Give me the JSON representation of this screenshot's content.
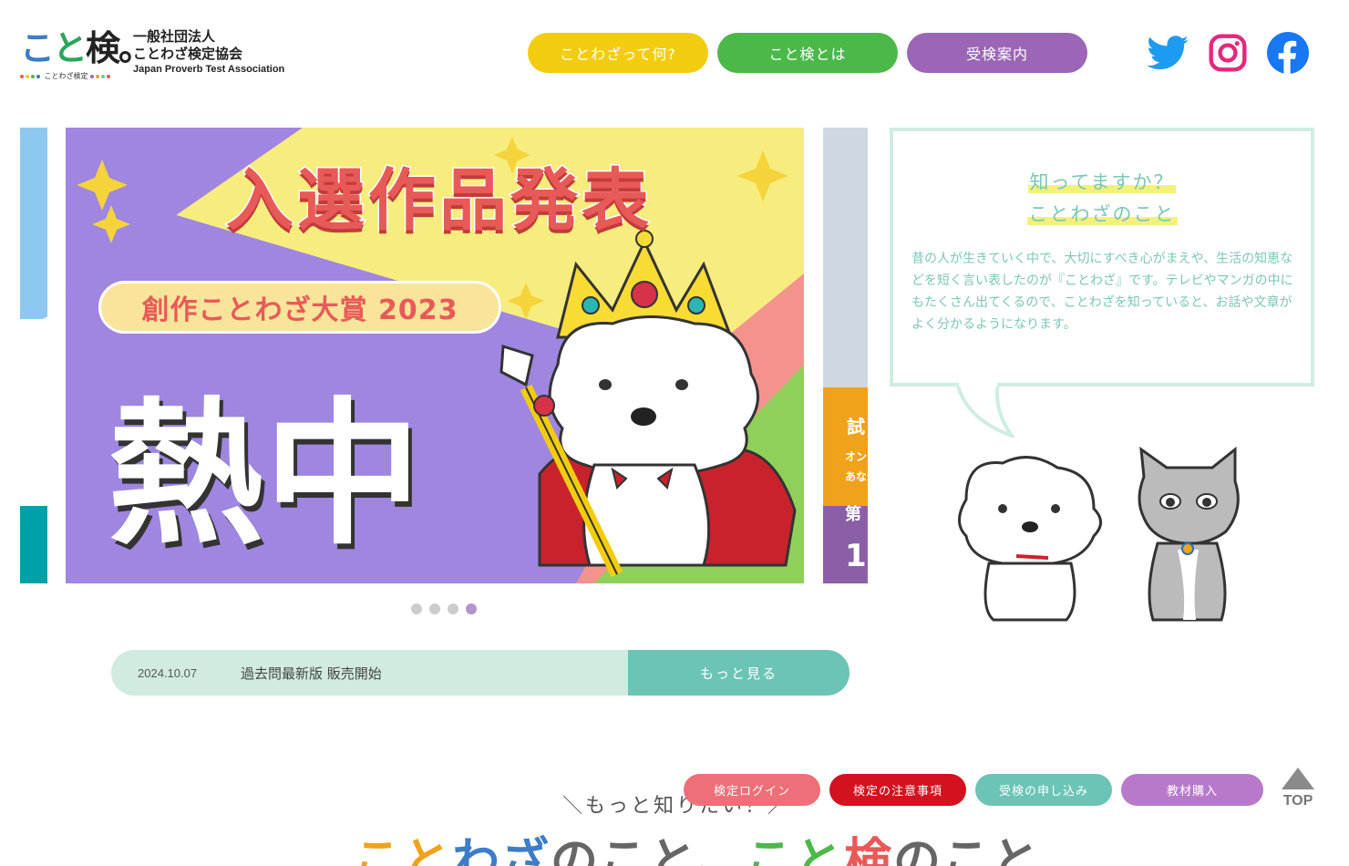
{
  "header": {
    "logo_mark": [
      "こ",
      "と",
      "検。"
    ],
    "logo_dots_text": "ことわざ検定",
    "logo_line1": "一般社団法人",
    "logo_line2": "ことわざ検定協会",
    "logo_line3": "Japan Proverb Test Association",
    "nav": [
      {
        "label": "ことわざって何?",
        "color": "#f2cd0f"
      },
      {
        "label": "こと検とは",
        "color": "#4db84a"
      },
      {
        "label": "受検案内",
        "color": "#9b66b5"
      }
    ],
    "social": [
      "twitter-icon",
      "instagram-icon",
      "facebook-icon"
    ]
  },
  "slider": {
    "title": "入選作品発表",
    "pill": "創作ことわざ大賞  2023",
    "big_text": "熱中",
    "next_slide": {
      "t1": "試",
      "t2a": "オン",
      "t2b": "あな",
      "t3": "第",
      "t4": "1"
    },
    "dots": 4,
    "active_dot": 4
  },
  "news": {
    "date": "2024.10.07",
    "text": "過去問最新版 販売開始",
    "more_label": "もっと見る"
  },
  "info": {
    "title_line1": "知ってますか？",
    "title_line2": "ことわざのこと",
    "body": "昔の人が生きていく中で、大切にすべき心がまえや、生活の知恵などを短く言い表したのが『ことわざ』です。テレビやマンガの中にもたくさん出てくるので、ことわざを知っていると、お話や文章がよく分かるようになります。"
  },
  "section": {
    "sub": "＼もっと知りたい！／",
    "main_parts": [
      "こと",
      "わざ",
      "のこと、",
      "こと",
      "検",
      "のこと"
    ]
  },
  "floating": {
    "buttons": [
      "検定ログイン",
      "検定の注意事項",
      "受検の申し込み",
      "教材購入"
    ],
    "top_label": "TOP"
  }
}
